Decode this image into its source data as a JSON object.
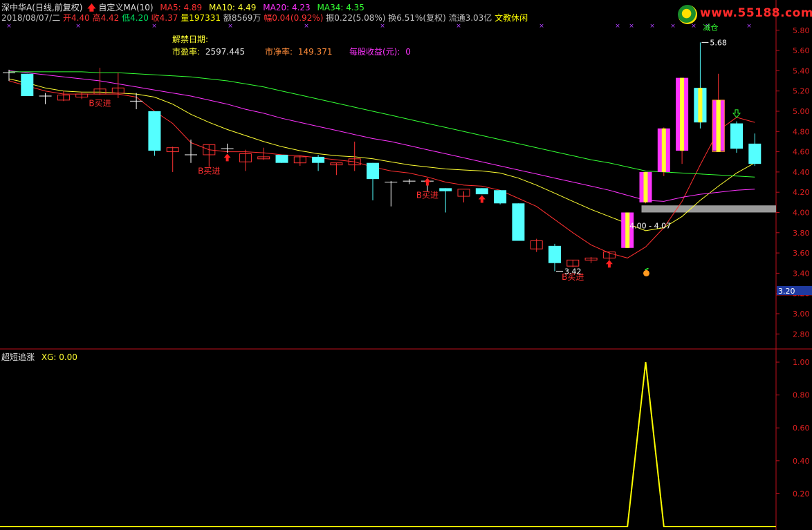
{
  "header": {
    "stock_title": "深中华A(日线,前复权)",
    "indicator_label": "自定义MA(10)",
    "ma5": "MA5: 4.89",
    "ma10": "MA10: 4.49",
    "ma20": "MA20: 4.23",
    "ma34": "MA34: 4.35",
    "info_line": [
      {
        "text": "2018/08/07/二",
        "color": "#c0c0c0"
      },
      {
        "text": " 开4.40",
        "color": "#ff3333"
      },
      {
        "text": " 高4.42",
        "color": "#ff3333"
      },
      {
        "text": " 低4.20",
        "color": "#00e060"
      },
      {
        "text": " 收4.37",
        "color": "#ff3333"
      },
      {
        "text": " 量197331",
        "color": "#ffff00"
      },
      {
        "text": " 额8569万",
        "color": "#c0c0c0"
      },
      {
        "text": " 幅0.04(0.92%)",
        "color": "#ff3333"
      },
      {
        "text": " 振0.22(5.08%)",
        "color": "#c0c0c0"
      },
      {
        "text": " 换6.51%(复权)",
        "color": "#c0c0c0"
      },
      {
        "text": " 流通3.03亿",
        "color": "#c0c0c0"
      },
      {
        "text": " 文教休闲",
        "color": "#ffff00"
      }
    ]
  },
  "fundamentals": {
    "unlock_label": "解禁日期:",
    "pe_label": "市盈率:",
    "pe_value": "2597.445",
    "pb_label": "市净率:",
    "pb_value": "149.371",
    "eps_label": "每股收益(元):",
    "eps_value": "0"
  },
  "watermark": "www.55188.com",
  "sub_panel": {
    "title": "超短追涨",
    "xg_label": "XG: 0.00"
  },
  "colors": {
    "up": "#ff3333",
    "down": "#54ffff",
    "ma5": "#ff3030",
    "ma10": "#ffff33",
    "ma20": "#ff33ff",
    "ma34": "#33ff33",
    "signal": "#ffff00",
    "axis": "#c0101c"
  },
  "chart_data": [
    {
      "type": "candlestick",
      "y_axis_ticks": [
        "5.80",
        "5.60",
        "5.40",
        "5.20",
        "5.00",
        "4.80",
        "4.60",
        "4.40",
        "4.20",
        "4.00",
        "3.80",
        "3.60",
        "3.40",
        "3.20",
        "3.00",
        "2.80"
      ],
      "ylim": [
        2.72,
        5.86
      ],
      "current_price_label": "3.20",
      "candles": [
        {
          "o": 5.38,
          "h": 5.41,
          "l": 5.3,
          "c": 5.38
        },
        {
          "o": 5.37,
          "h": 5.37,
          "l": 5.15,
          "c": 5.15
        },
        {
          "o": 5.15,
          "h": 5.18,
          "l": 5.07,
          "c": 5.15
        },
        {
          "o": 5.11,
          "h": 5.2,
          "l": 5.1,
          "c": 5.16
        },
        {
          "o": 5.14,
          "h": 5.19,
          "l": 5.12,
          "c": 5.17
        },
        {
          "o": 5.17,
          "h": 5.43,
          "l": 5.16,
          "c": 5.22
        },
        {
          "o": 5.18,
          "h": 5.38,
          "l": 5.13,
          "c": 5.23
        },
        {
          "o": 5.1,
          "h": 5.18,
          "l": 5.02,
          "c": 5.1
        },
        {
          "o": 5.0,
          "h": 5.0,
          "l": 4.56,
          "c": 4.61
        },
        {
          "o": 4.6,
          "h": 4.65,
          "l": 4.4,
          "c": 4.64
        },
        {
          "o": 4.57,
          "h": 4.72,
          "l": 4.49,
          "c": 4.57
        },
        {
          "o": 4.57,
          "h": 4.67,
          "l": 4.45,
          "c": 4.67
        },
        {
          "o": 4.63,
          "h": 4.68,
          "l": 4.59,
          "c": 4.63
        },
        {
          "o": 4.5,
          "h": 4.62,
          "l": 4.41,
          "c": 4.58
        },
        {
          "o": 4.53,
          "h": 4.64,
          "l": 4.52,
          "c": 4.55
        },
        {
          "o": 4.57,
          "h": 4.57,
          "l": 4.49,
          "c": 4.49
        },
        {
          "o": 4.49,
          "h": 4.56,
          "l": 4.46,
          "c": 4.55
        },
        {
          "o": 4.55,
          "h": 4.57,
          "l": 4.41,
          "c": 4.49
        },
        {
          "o": 4.47,
          "h": 4.49,
          "l": 4.37,
          "c": 4.49
        },
        {
          "o": 4.47,
          "h": 4.7,
          "l": 4.41,
          "c": 4.53
        },
        {
          "o": 4.49,
          "h": 4.49,
          "l": 4.12,
          "c": 4.33
        },
        {
          "o": 4.29,
          "h": 4.31,
          "l": 4.06,
          "c": 4.3
        },
        {
          "o": 4.3,
          "h": 4.33,
          "l": 4.28,
          "c": 4.31
        },
        {
          "o": 4.31,
          "h": 4.33,
          "l": 4.21,
          "c": 4.31
        },
        {
          "o": 4.24,
          "h": 4.24,
          "l": 4.0,
          "c": 4.21
        },
        {
          "o": 4.16,
          "h": 4.21,
          "l": 4.1,
          "c": 4.23
        },
        {
          "o": 4.24,
          "h": 4.24,
          "l": 4.18,
          "c": 4.18
        },
        {
          "o": 4.22,
          "h": 4.22,
          "l": 4.08,
          "c": 4.09
        },
        {
          "o": 4.09,
          "h": 4.09,
          "l": 3.72,
          "c": 3.72
        },
        {
          "o": 3.64,
          "h": 3.74,
          "l": 3.61,
          "c": 3.72
        },
        {
          "o": 3.67,
          "h": 3.69,
          "l": 3.42,
          "c": 3.5
        },
        {
          "o": 3.47,
          "h": 3.53,
          "l": 3.46,
          "c": 3.53
        },
        {
          "o": 3.53,
          "h": 3.56,
          "l": 3.5,
          "c": 3.55
        },
        {
          "o": 3.55,
          "h": 3.61,
          "l": 3.53,
          "c": 3.61
        },
        {
          "o": 3.65,
          "h": 4.0,
          "l": 3.65,
          "c": 4.0
        },
        {
          "o": 4.1,
          "h": 4.4,
          "l": 4.09,
          "c": 4.4
        },
        {
          "o": 4.4,
          "h": 4.84,
          "l": 4.36,
          "c": 4.83
        },
        {
          "o": 4.61,
          "h": 5.33,
          "l": 4.48,
          "c": 5.33
        },
        {
          "o": 5.23,
          "h": 5.68,
          "l": 4.83,
          "c": 4.89
        },
        {
          "o": 4.61,
          "h": 5.37,
          "l": 4.6,
          "c": 5.11
        },
        {
          "o": 4.88,
          "h": 4.9,
          "l": 4.59,
          "c": 4.63
        },
        {
          "o": 4.68,
          "h": 4.78,
          "l": 4.46,
          "c": 4.48
        }
      ],
      "series": [
        {
          "name": "MA5",
          "points": [
            5.3,
            5.25,
            5.2,
            5.17,
            5.17,
            5.17,
            5.17,
            5.14,
            5.0,
            4.88,
            4.69,
            4.62,
            4.6,
            4.6,
            4.59,
            4.57,
            4.56,
            4.54,
            4.52,
            4.5,
            4.45,
            4.41,
            4.39,
            4.35,
            4.3,
            4.27,
            4.26,
            4.22,
            4.14,
            4.06,
            3.93,
            3.8,
            3.68,
            3.6,
            3.55,
            3.66,
            3.85,
            4.11,
            4.47,
            4.81,
            4.94,
            4.89
          ]
        },
        {
          "name": "MA10",
          "points": [
            5.32,
            5.28,
            5.23,
            5.2,
            5.19,
            5.19,
            5.18,
            5.17,
            5.14,
            5.07,
            4.97,
            4.89,
            4.82,
            4.76,
            4.7,
            4.65,
            4.61,
            4.58,
            4.56,
            4.55,
            4.53,
            4.5,
            4.47,
            4.45,
            4.43,
            4.42,
            4.41,
            4.39,
            4.34,
            4.27,
            4.19,
            4.11,
            4.03,
            3.96,
            3.89,
            3.82,
            3.85,
            3.96,
            4.12,
            4.26,
            4.39,
            4.49
          ]
        },
        {
          "name": "MA20",
          "points": [
            5.4,
            5.38,
            5.36,
            5.34,
            5.32,
            5.3,
            5.27,
            5.24,
            5.21,
            5.18,
            5.15,
            5.11,
            5.07,
            5.02,
            4.98,
            4.93,
            4.89,
            4.85,
            4.81,
            4.77,
            4.73,
            4.7,
            4.66,
            4.62,
            4.58,
            4.54,
            4.5,
            4.46,
            4.42,
            4.38,
            4.34,
            4.3,
            4.26,
            4.22,
            4.17,
            4.12,
            4.11,
            4.15,
            4.18,
            4.2,
            4.22,
            4.23
          ]
        },
        {
          "name": "MA34",
          "points": [
            5.39,
            5.39,
            5.39,
            5.39,
            5.39,
            5.38,
            5.38,
            5.37,
            5.36,
            5.35,
            5.34,
            5.32,
            5.3,
            5.27,
            5.24,
            5.2,
            5.16,
            5.12,
            5.08,
            5.04,
            5.0,
            4.96,
            4.92,
            4.88,
            4.84,
            4.8,
            4.76,
            4.72,
            4.68,
            4.64,
            4.6,
            4.56,
            4.52,
            4.49,
            4.45,
            4.41,
            4.4,
            4.39,
            4.38,
            4.37,
            4.36,
            4.35
          ]
        }
      ],
      "signals": [
        {
          "label": "B买进",
          "index": 5,
          "price": 5.08,
          "arrow": false
        },
        {
          "label": "B买进",
          "index": 11,
          "price": 4.41,
          "arrow": true,
          "arrow_index": 12
        },
        {
          "label": "B买进",
          "index": 23,
          "price": 4.17,
          "arrow": true,
          "arrow_index": 23
        },
        {
          "label": "B买进",
          "index": 31,
          "price": 3.36,
          "arrow": true,
          "arrow_index": 33
        }
      ],
      "red_arrows_extra": [
        26
      ],
      "sell_arrow_index": 40,
      "annotations": [
        {
          "text": "5.68",
          "index": 38,
          "price": 5.68
        },
        {
          "text": "3.42",
          "index": 30,
          "price": 3.42
        },
        {
          "text": "4.00 - 4.07",
          "index": 34,
          "price": 3.94
        },
        {
          "text": "减仓",
          "index": 38,
          "price": 5.83
        }
      ],
      "support_band": {
        "from_index": 35,
        "low": 4.0,
        "high": 4.07
      }
    },
    {
      "type": "line",
      "title": "超短追涨",
      "y_axis_ticks": [
        "1.00",
        "0.80",
        "0.60",
        "0.40",
        "0.20"
      ],
      "ylim": [
        0,
        1.08
      ],
      "values": [
        0,
        0,
        0,
        0,
        0,
        0,
        0,
        0,
        0,
        0,
        0,
        0,
        0,
        0,
        0,
        0,
        0,
        0,
        0,
        0,
        0,
        0,
        0,
        0,
        0,
        0,
        0,
        0,
        0,
        0,
        0,
        0,
        0,
        0,
        0,
        1,
        0,
        0,
        0,
        0,
        0,
        0
      ]
    }
  ]
}
